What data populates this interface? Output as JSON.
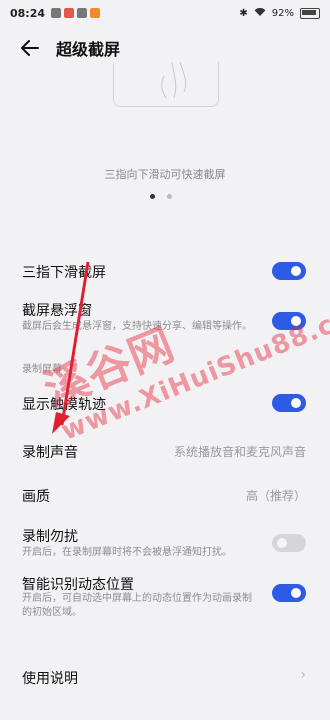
{
  "status": {
    "time": "08:24",
    "battery": "92%",
    "notif_colors": [
      "#777777",
      "#e2584a",
      "#777777",
      "#f08a2a"
    ]
  },
  "header": {
    "title": "超级截屏",
    "back_icon": "arrow-left-icon"
  },
  "preview": {
    "caption": "三指向下滑动可快速截屏",
    "page_count": 2,
    "active_page": 1
  },
  "items": {
    "three_finger": {
      "label": "三指下滑截屏",
      "on": true
    },
    "float_window": {
      "label": "截屏悬浮窗",
      "desc": "截屏后会生成悬浮窗，支持快速分享、编辑等操作。",
      "on": true
    },
    "record_section": "录制屏幕",
    "show_touch": {
      "label": "显示触摸轨迹",
      "on": true
    },
    "record_sound": {
      "label": "录制声音",
      "value": "系统播放音和麦克风声音"
    },
    "quality": {
      "label": "画质",
      "value": "高（推荐）"
    },
    "dnd": {
      "label": "录制勿扰",
      "desc": "开启后，在录制屏幕时将不会被悬浮通知打扰。",
      "on": false
    },
    "smart": {
      "label": "智能识别动态位置",
      "desc": "开启后，可自动选中屏幕上的动态位置作为动画录制的初始区域。",
      "on": true
    },
    "help": {
      "label": "使用说明"
    }
  },
  "colors": {
    "accent": "#2e5be6",
    "arrow": "#e02030"
  },
  "watermark": {
    "line1": "溪谷网",
    "line2": "www.XiHuiShu88.com"
  }
}
